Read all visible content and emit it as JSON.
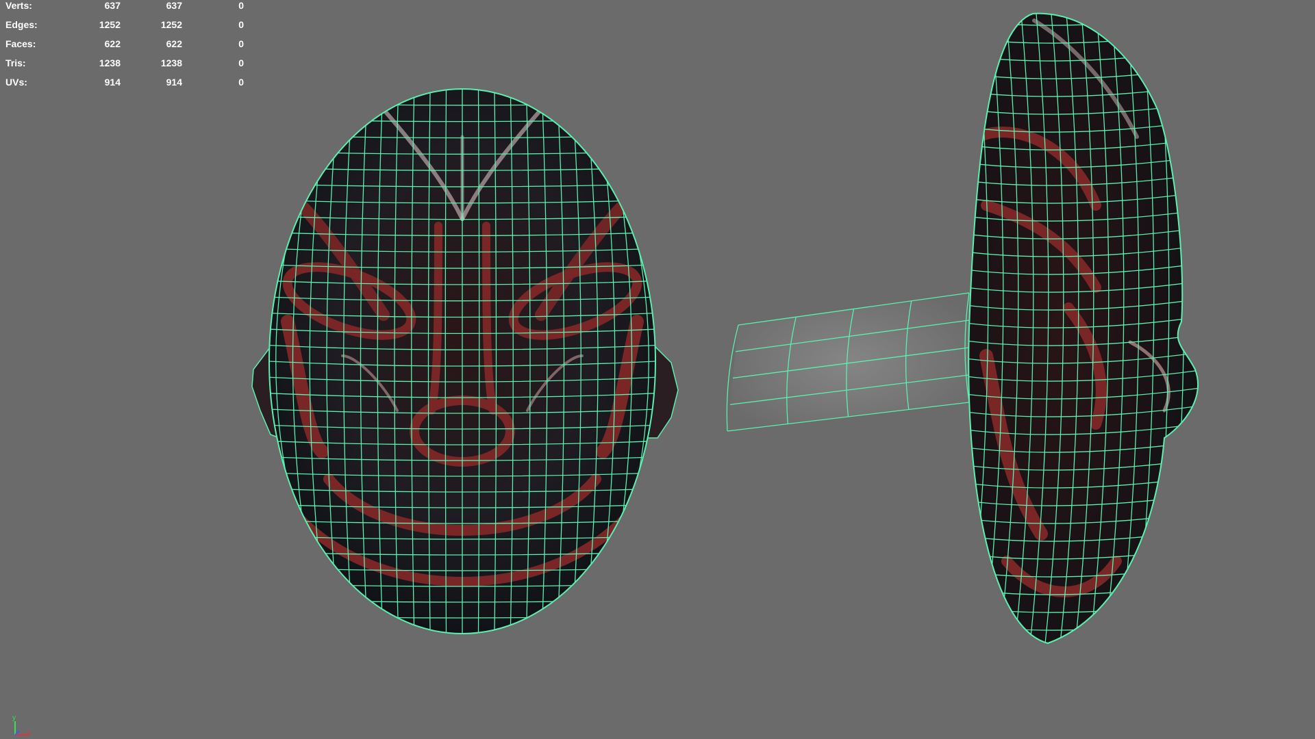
{
  "hud": {
    "rows": [
      {
        "label": "Verts:",
        "v1": "637",
        "v2": "637",
        "v3": "0"
      },
      {
        "label": "Edges:",
        "v1": "1252",
        "v2": "1252",
        "v3": "0"
      },
      {
        "label": "Faces:",
        "v1": "622",
        "v2": "622",
        "v3": "0"
      },
      {
        "label": "Tris:",
        "v1": "1238",
        "v2": "1238",
        "v3": "0"
      },
      {
        "label": "UVs:",
        "v1": "914",
        "v2": "914",
        "v3": "0"
      }
    ]
  },
  "axis": {
    "y_label": "y",
    "x_label": "x"
  },
  "colors": {
    "viewport_bg": "#6b6b6b",
    "wireframe": "#5cf0b0",
    "mask_base": "#1a1d24",
    "mask_red": "#8a2a2a",
    "axis_x": "#e03535",
    "axis_y": "#35e05a",
    "axis_z": "#3a5aff"
  }
}
